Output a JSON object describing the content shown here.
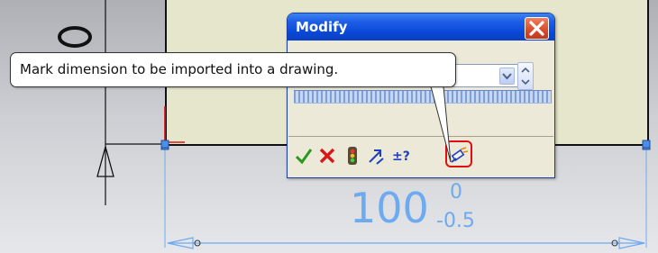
{
  "dialog": {
    "title": "Modify",
    "close_icon": "close-icon",
    "value": ""
  },
  "tooltip": {
    "text": "Mark dimension to be imported into a drawing."
  },
  "toolbar": {
    "buttons": [
      {
        "name": "ok-button",
        "icon": "checkmark-icon"
      },
      {
        "name": "cancel-button",
        "icon": "x-icon"
      },
      {
        "name": "rebuild-button",
        "icon": "traffic-light-icon"
      },
      {
        "name": "reverse-dimension-button",
        "icon": "reverse-arrow-icon"
      },
      {
        "name": "tolerance-button",
        "icon": "plus-minus-question-icon"
      },
      {
        "name": "mark-for-drawing-button",
        "icon": "mark-dimension-icon"
      }
    ]
  },
  "dimension": {
    "value": "100",
    "upper_tolerance": "0",
    "lower_tolerance": "-0.5",
    "color": "#6eaaf0"
  },
  "colors": {
    "panel": "#e6e6cc",
    "title_bar": "#0a48d8",
    "dimension": "#6eaaf0",
    "highlight": "#e01010"
  }
}
